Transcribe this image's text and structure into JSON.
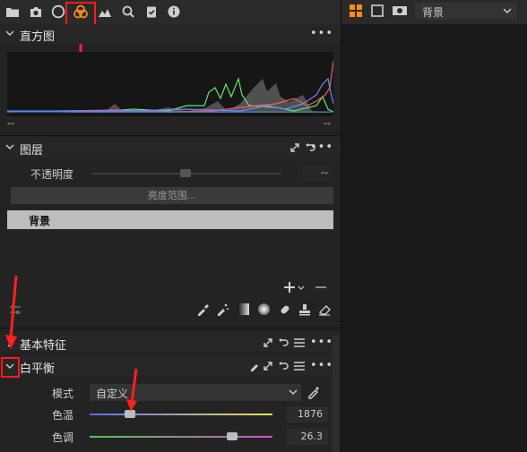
{
  "toolbar": {
    "icons": [
      "folder-icon",
      "camera-icon",
      "circle-icon",
      "color-icon",
      "mountain-icon",
      "search-icon",
      "clipboard-check-icon",
      "info-icon"
    ]
  },
  "histogram": {
    "title": "直方图",
    "left_value": "--",
    "right_value": "--"
  },
  "layers": {
    "title": "图层",
    "opacity_label": "不透明度",
    "opacity_value": "--",
    "luminance_button": "亮度范围...",
    "layer_name": "背景"
  },
  "basic": {
    "title": "基本特征"
  },
  "white_balance": {
    "title": "白平衡",
    "mode_label": "模式",
    "mode_value": "自定义",
    "temp_label": "色温",
    "temp_value": "1876",
    "temp_level": 0.22,
    "tint_label": "色调",
    "tint_value": "26.3",
    "tint_level": 0.78
  },
  "right_panel": {
    "layer_select": "背景"
  },
  "colors": {
    "accent": "#ff8a1a",
    "highlight": "#ff1a1a"
  }
}
